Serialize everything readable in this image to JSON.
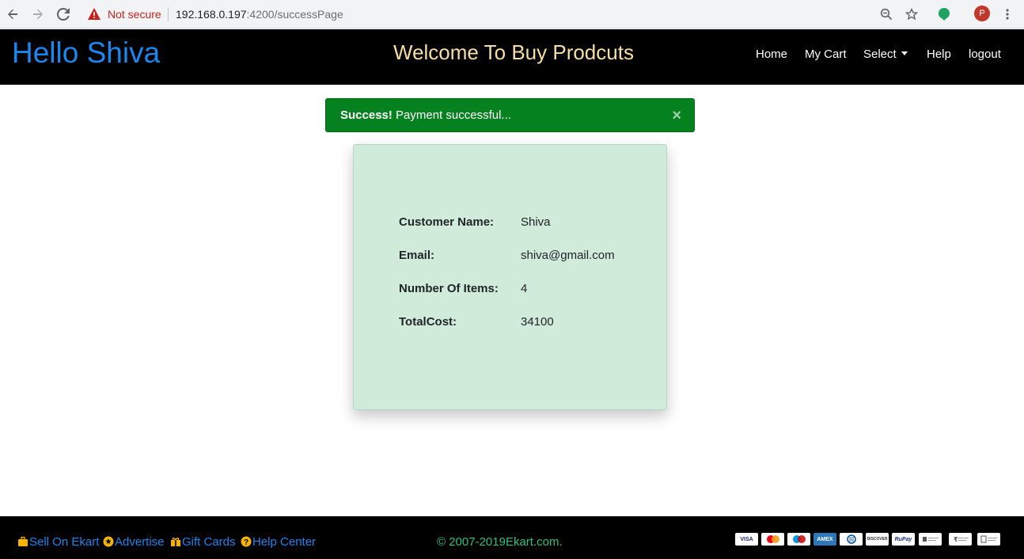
{
  "browser": {
    "security_label": "Not secure",
    "url_host": "192.168.0.197",
    "url_path": ":4200/successPage",
    "profile_initial": "P"
  },
  "navbar": {
    "greeting": "Hello Shiva",
    "welcome": "Welcome To Buy Prodcuts",
    "links": {
      "home": "Home",
      "cart": "My Cart",
      "select": "Select",
      "help": "Help",
      "logout": "logout"
    }
  },
  "alert": {
    "strong": "Success!",
    "message": "Payment successful...",
    "close": "×"
  },
  "summary": {
    "customer_label": "Customer Name:",
    "customer_value": "Shiva",
    "email_label": "Email:",
    "email_value": "shiva@gmail.com",
    "items_label": "Number Of Items:",
    "items_value": "4",
    "cost_label": "TotalCost:",
    "cost_value": "34100"
  },
  "footer": {
    "sell": "Sell On Ekart",
    "advertise": "Advertise",
    "gift": "Gift Cards",
    "help": "Help Center",
    "copyright": "© 2007-2019Ekart.com.",
    "payments": [
      "VISA",
      "",
      "",
      "AMEX",
      "",
      "DISCOVER",
      "RuPay",
      "",
      "",
      ""
    ]
  },
  "colors": {
    "brand": "#1a86f0",
    "welcome": "#f6dfa6",
    "alert_bg": "#05821f",
    "card_bg": "#d1ebdb",
    "copyright": "#2ec27e"
  }
}
